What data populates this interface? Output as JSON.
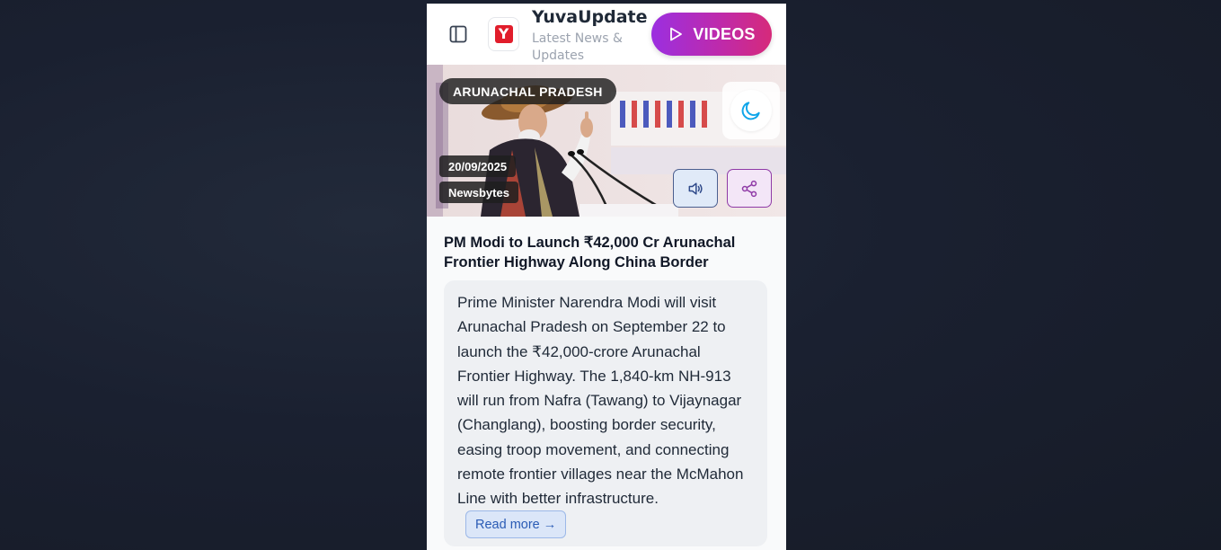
{
  "header": {
    "brand_name": "YuvaUpdate",
    "brand_tagline": "Latest News & Updates",
    "logo_letter": "Y",
    "videos_label": "VIDEOS"
  },
  "article": {
    "category": "ARUNACHAL PRADESH",
    "date": "20/09/2025",
    "source": "Newsbytes",
    "title": "PM Modi to Launch ₹42,000 Cr Arunachal Frontier Highway Along China Border",
    "summary": "Prime Minister Narendra Modi will visit Arunachal Pradesh on September 22 to launch the ₹42,000-crore Arunachal Frontier Highway. The 1,840-km NH-913 will run from Nafra (Tawang) to Vijaynagar (Changlang), boosting border security, easing troop movement, and connecting remote frontier villages near the McMahon Line with better infrastructure.",
    "read_more_label": "Read more →"
  },
  "icons": {
    "sidebar": "sidebar-toggle-icon",
    "play": "play-icon",
    "theme": "moon-icon",
    "audio": "speaker-icon",
    "share": "share-icon"
  },
  "colors": {
    "brand_red": "#e11d2b",
    "videos_gradient_start": "#9b2fe0",
    "videos_gradient_end": "#d62a7a",
    "audio_accent": "#2f4a8a",
    "share_accent": "#8f3aa6",
    "link_blue": "#2a5bb5",
    "moon_blue": "#0ea5e9"
  }
}
